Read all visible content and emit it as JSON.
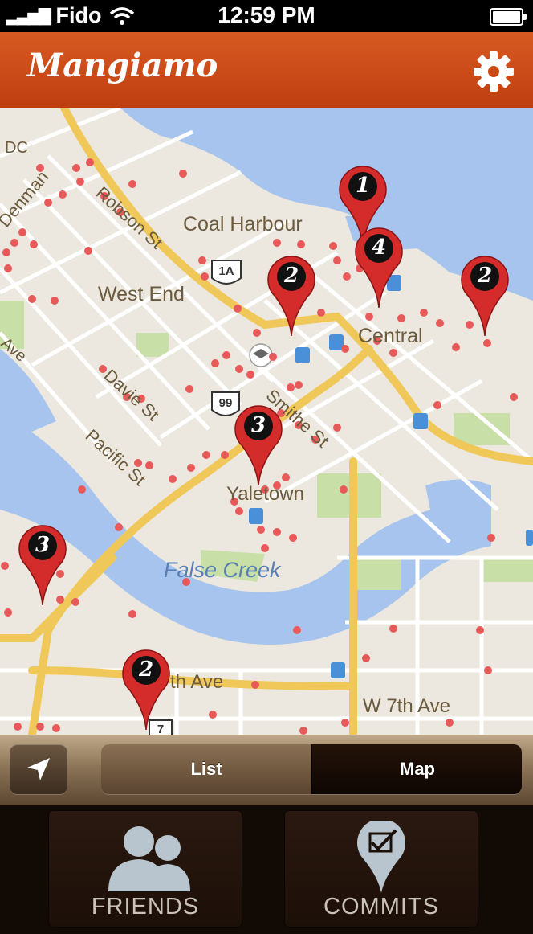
{
  "status_bar": {
    "carrier": "Fido",
    "time": "12:59 PM"
  },
  "header": {
    "title": "Mangiamo",
    "settings_icon": "gear-icon"
  },
  "map": {
    "labels": {
      "coal_harbour": "Coal Harbour",
      "west_end": "West End",
      "central": "Central",
      "yaletown": "Yaletown",
      "false_creek": "False Creek",
      "robson_st": "Robson St",
      "davie_st": "Davie St",
      "pacific_st": "Pacific St",
      "smithe_st": "Smithe St",
      "w7th_ave": "W 7th Ave",
      "th_ave": "th Ave",
      "ave": "Ave",
      "dc": "DC",
      "denman": "Denman",
      "hwy_1a": "1A",
      "hwy_99": "99",
      "hwy_7": "7"
    },
    "pins": [
      {
        "count": "1"
      },
      {
        "count": "4"
      },
      {
        "count": "2"
      },
      {
        "count": "2"
      },
      {
        "count": "3"
      },
      {
        "count": "3"
      },
      {
        "count": "2"
      }
    ],
    "colors": {
      "pin": "#d42b2b",
      "dot": "#e85a5a",
      "water": "#a6c4ee",
      "road_major": "#f5d36a",
      "park": "#c8dfa8"
    }
  },
  "toolbar": {
    "locate_icon": "location-arrow-icon",
    "segments": {
      "list": "List",
      "map": "Map"
    },
    "selected": "Map"
  },
  "tabs": {
    "friends": "FRIENDS",
    "commits": "COMMITS"
  }
}
